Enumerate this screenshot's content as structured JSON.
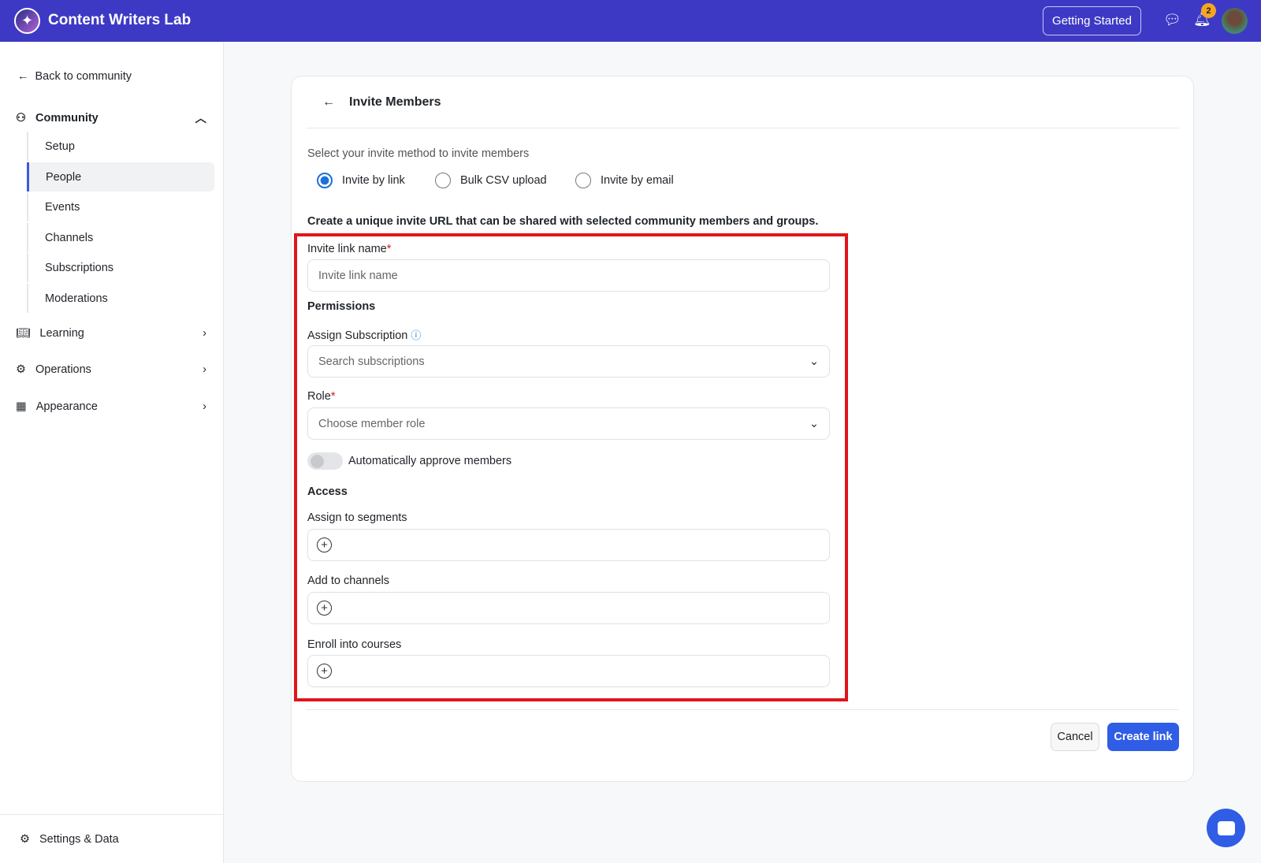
{
  "header": {
    "app_title": "Content Writers Lab",
    "getting_started": "Getting Started",
    "notification_count": "2"
  },
  "sidebar": {
    "back": "Back to community",
    "community": "Community",
    "sub_items": [
      "Setup",
      "People",
      "Events",
      "Channels",
      "Subscriptions",
      "Moderations"
    ],
    "learning": "Learning",
    "operations": "Operations",
    "appearance": "Appearance",
    "settings": "Settings & Data"
  },
  "main": {
    "title": "Invite Members",
    "method_prompt": "Select your invite method to invite members",
    "methods": [
      "Invite by link",
      "Bulk CSV upload",
      "Invite by email"
    ],
    "description": "Create a unique invite URL that can be shared with selected community members and groups.",
    "invite_name_label": "Invite link name",
    "required": "*",
    "invite_name_placeholder": "Invite link name",
    "permissions": "Permissions",
    "assign_sub_label": "Assign Subscription",
    "sub_placeholder": "Search subscriptions",
    "role_label": "Role",
    "role_placeholder": "Choose member role",
    "auto_approve": "Automatically approve members",
    "access": "Access",
    "segments": "Assign to segments",
    "channels": "Add to channels",
    "courses": "Enroll into courses",
    "cancel": "Cancel",
    "create": "Create link"
  }
}
